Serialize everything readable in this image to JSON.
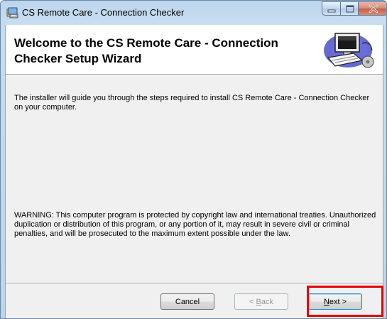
{
  "window": {
    "title": "CS Remote Care - Connection Checker"
  },
  "banner": {
    "title": "Welcome to the CS Remote Care - Connection Checker Setup Wizard"
  },
  "content": {
    "intro": "The installer will guide you through the steps required to install CS Remote Care - Connection Checker on your computer.",
    "warning": "WARNING: This computer program is protected by copyright law and international treaties. Unauthorized duplication or distribution of this program, or any portion of it, may result in severe civil or criminal penalties, and will be prosecuted to the maximum extent possible under the law."
  },
  "buttons": {
    "cancel": "Cancel",
    "back_prefix": "< ",
    "back_accel": "B",
    "back_rest": "ack",
    "next_accel": "N",
    "next_rest": "ext >"
  },
  "colors": {
    "highlight": "#e30000",
    "titlebar": "#bcd6ee"
  }
}
